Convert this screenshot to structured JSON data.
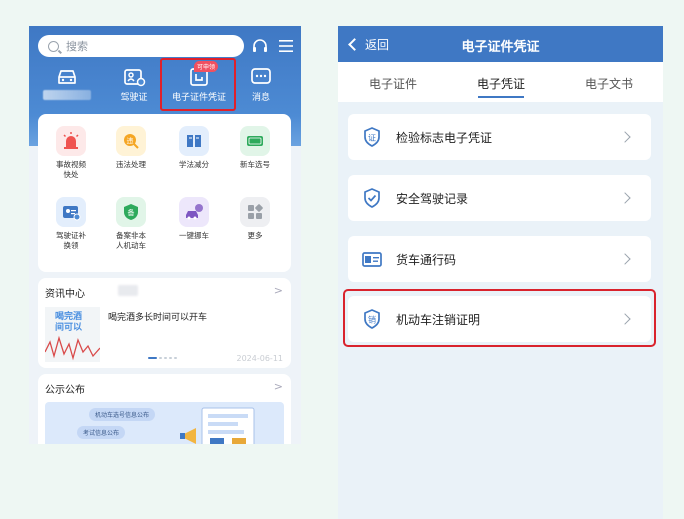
{
  "left": {
    "search_placeholder": "搜索",
    "top_tiles": [
      {
        "label": "",
        "icon": "car-icon"
      },
      {
        "label": "驾驶证",
        "icon": "license-icon"
      },
      {
        "label": "电子证件凭证",
        "icon": "certificate-icon"
      },
      {
        "label": "消息",
        "icon": "message-icon"
      }
    ],
    "badge": "可申领",
    "services": [
      {
        "label": "事故视频\n快处",
        "icon": "alarm-icon",
        "color": "#fde9e9"
      },
      {
        "label": "违法处理",
        "icon": "violation-icon",
        "color": "#fff3d6"
      },
      {
        "label": "学法减分",
        "icon": "book-icon",
        "color": "#e3eefc"
      },
      {
        "label": "新车选号",
        "icon": "new-plate-icon",
        "color": "#e1f5e8"
      },
      {
        "label": "驾驶证补\n换领",
        "icon": "id-card-icon",
        "color": "#e3eefc"
      },
      {
        "label": "备案非本\n人机动车",
        "icon": "record-icon",
        "color": "#e1f5e8"
      },
      {
        "label": "一键挪车",
        "icon": "move-car-icon",
        "color": "#ede7fb"
      },
      {
        "label": "更多",
        "icon": "more-icon",
        "color": "#eeeff2"
      }
    ],
    "news": {
      "title": "资讯中心",
      "image_text": "喝完酒\n间可以",
      "headline": "喝完酒多长时间可以开车",
      "date": "2024-06-11"
    },
    "notice": {
      "title": "公示公布",
      "pill1": "机动车选号信息公布",
      "pill2": "考试信息公布"
    }
  },
  "right": {
    "back_label": "返回",
    "title": "电子证件凭证",
    "tabs": [
      "电子证件",
      "电子凭证",
      "电子文书"
    ],
    "active_tab": 1,
    "items": [
      {
        "label": "检验标志电子凭证",
        "icon": "inspection-badge-icon"
      },
      {
        "label": "安全驾驶记录",
        "icon": "shield-check-icon"
      },
      {
        "label": "货车通行码",
        "icon": "pass-card-icon"
      },
      {
        "label": "机动车注销证明",
        "icon": "cancel-cert-icon"
      }
    ]
  },
  "colors": {
    "primary": "#3f78c4",
    "highlight": "#d9232d",
    "page_bg": "#eef7f3"
  }
}
